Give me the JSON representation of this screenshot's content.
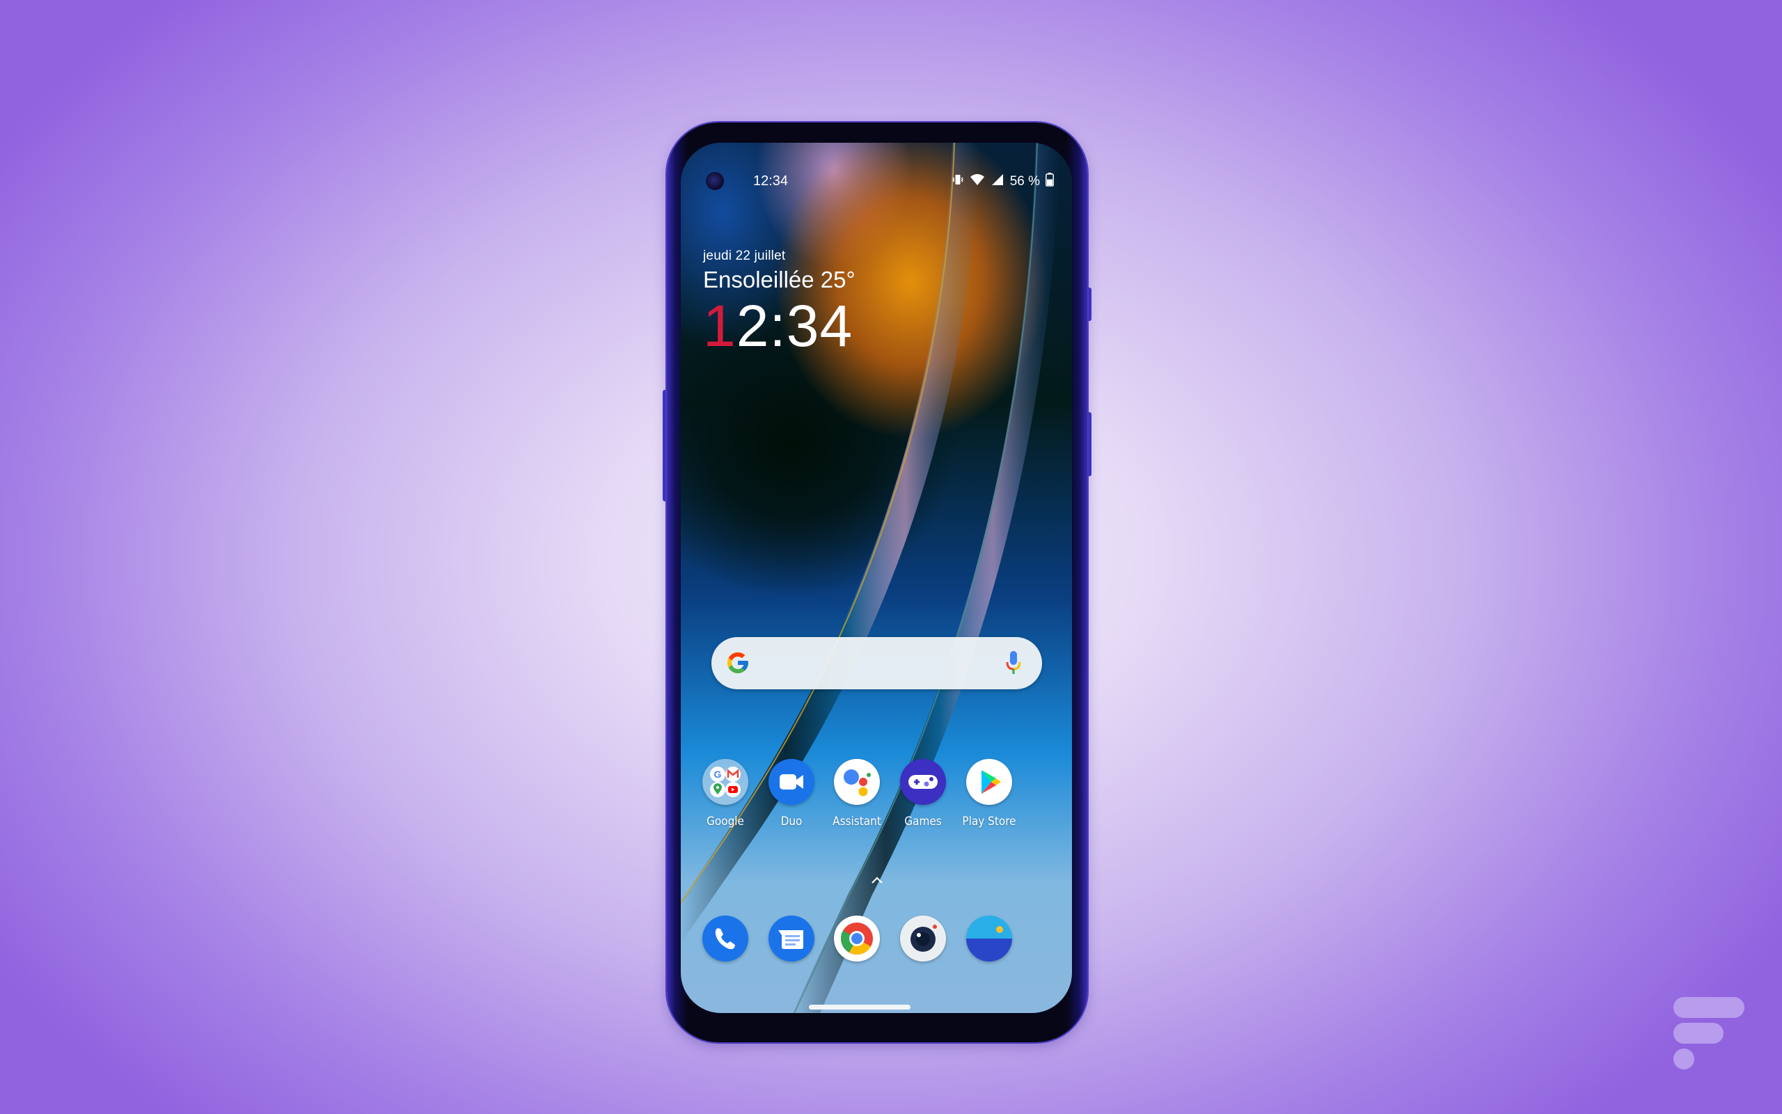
{
  "status_bar": {
    "time": "12:34",
    "battery_text": "56 %",
    "battery_level": 0.56,
    "icons": [
      "vibrate-icon",
      "wifi-icon",
      "signal-icon",
      "battery-icon"
    ]
  },
  "lockscreen_widget": {
    "date": "jeudi 22 juillet",
    "weather": "Ensoleillée 25°",
    "clock_first_digit": "1",
    "clock_rest": "2:34"
  },
  "search_bar": {
    "placeholder": "",
    "logo": "google-g-icon",
    "mic": "mic-icon"
  },
  "home_apps": [
    {
      "label": "Google",
      "icon": "google-folder-icon"
    },
    {
      "label": "Duo",
      "icon": "duo-icon"
    },
    {
      "label": "Assistant",
      "icon": "assistant-icon"
    },
    {
      "label": "Games",
      "icon": "games-icon"
    },
    {
      "label": "Play Store",
      "icon": "play-store-icon"
    }
  ],
  "dock_apps": [
    {
      "name": "Phone",
      "icon": "phone-icon"
    },
    {
      "name": "Messages",
      "icon": "messages-icon"
    },
    {
      "name": "Chrome",
      "icon": "chrome-icon"
    },
    {
      "name": "Camera",
      "icon": "camera-icon"
    },
    {
      "name": "Gallery",
      "icon": "gallery-icon"
    }
  ],
  "colors": {
    "clock_accent": "#d41a3b",
    "background_center": "#f2ebfa",
    "background_edge": "#9163df",
    "phone_frame": "#3a2bb0"
  },
  "watermark": "frandroid-logo"
}
